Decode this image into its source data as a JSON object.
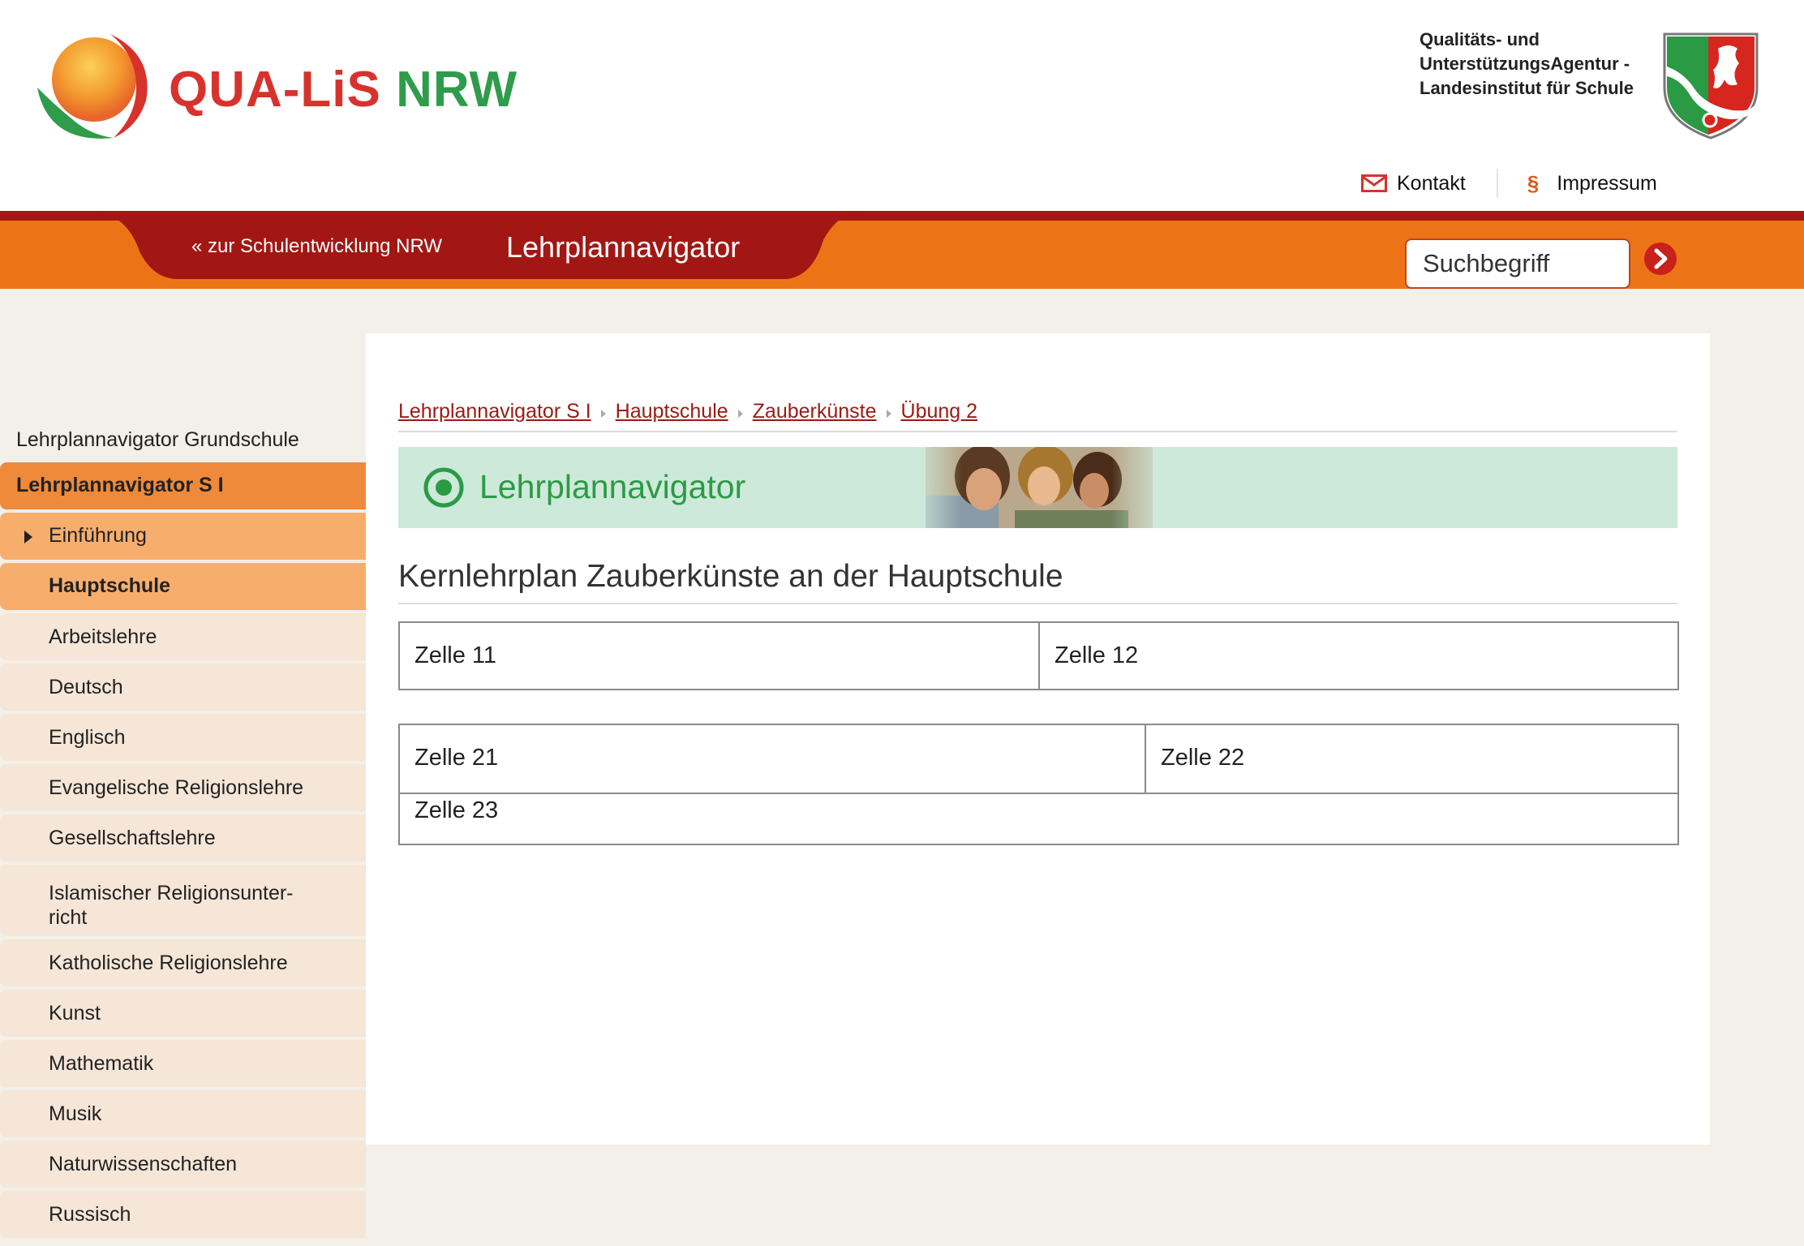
{
  "brand": {
    "part1": "QUA-LiS",
    "part2": "NRW"
  },
  "agency": {
    "lines": [
      "Qualitäts- und",
      "UnterstützungsAgentur -",
      "Landesinstitut für Schule"
    ]
  },
  "toplinks": {
    "kontakt": "Kontakt",
    "impressum_icon": "§",
    "impressum": "Impressum"
  },
  "nav": {
    "back_link": "« zur Schulentwicklung NRW",
    "title": "Lehrplannavigator"
  },
  "search": {
    "placeholder": "Suchbegriff"
  },
  "sidebar": {
    "items": [
      "Lehrplannavigator Grundschule",
      "Lehrplannavigator S I",
      "Einführung",
      "Hauptschule",
      "Arbeitslehre",
      "Deutsch",
      "Englisch",
      "Evangelische Religionslehre",
      "Gesellschaftslehre",
      "Katholische Religionslehre",
      "Kunst",
      "Mathematik",
      "Musik",
      "Naturwissenschaften",
      "Russisch"
    ],
    "islam_line1": "Islamischer Religionsunter-",
    "islam_line2": "richt"
  },
  "breadcrumb": [
    "Lehrplannavigator S I",
    "Hauptschule",
    "Zauberkünste",
    "Übung 2"
  ],
  "banner": {
    "title": "Lehrplannavigator"
  },
  "page": {
    "title": "Kernlehrplan Zauberkünste an der Hauptschule"
  },
  "table1": [
    "Zelle 11",
    "Zelle 12"
  ],
  "table2": [
    "Zelle 21",
    "Zelle 22",
    "Zelle 23"
  ],
  "colors": {
    "orange": "#ec7417",
    "dark_red": "#a21714",
    "green": "#2c9a45",
    "link_red": "#9b1a14"
  }
}
